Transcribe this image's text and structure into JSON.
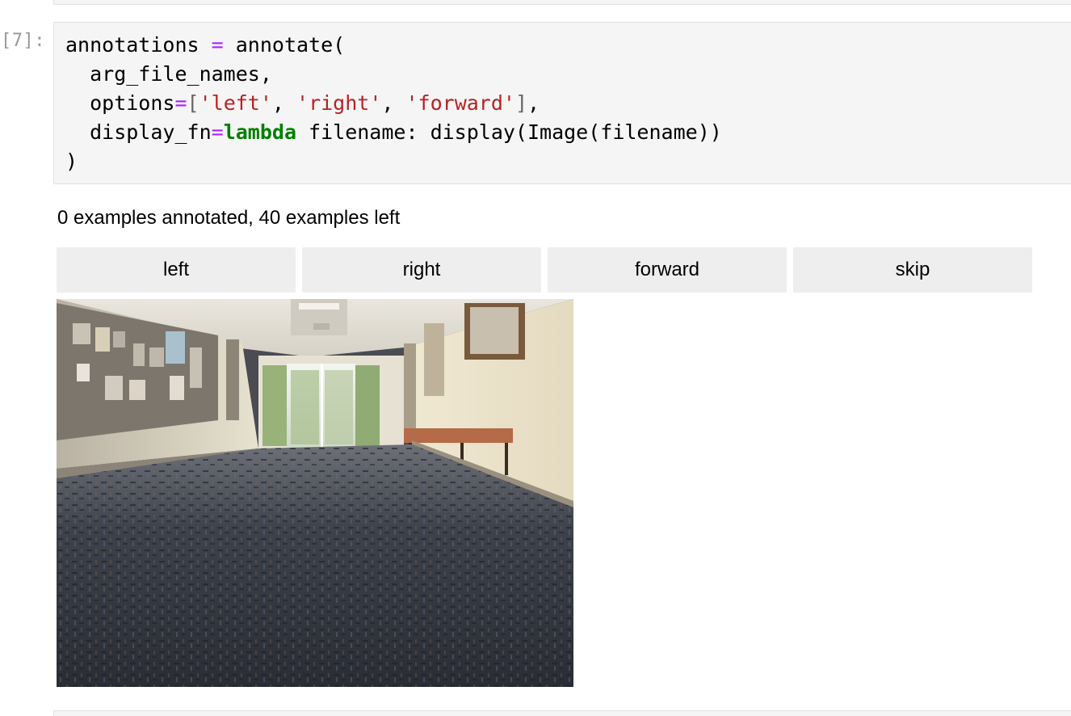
{
  "cell": {
    "prompt": "[7]:",
    "code_lines": [
      [
        {
          "t": "annotations ",
          "c": ""
        },
        {
          "t": "=",
          "c": "op"
        },
        {
          "t": " annotate(",
          "c": ""
        }
      ],
      [
        {
          "t": "  arg_file_names,",
          "c": ""
        }
      ],
      [
        {
          "t": "  options",
          "c": ""
        },
        {
          "t": "=",
          "c": "op"
        },
        {
          "t": "[",
          "c": "brk"
        },
        {
          "t": "'left'",
          "c": "str"
        },
        {
          "t": ", ",
          "c": ""
        },
        {
          "t": "'right'",
          "c": "str"
        },
        {
          "t": ", ",
          "c": ""
        },
        {
          "t": "'forward'",
          "c": "str"
        },
        {
          "t": "]",
          "c": "brk"
        },
        {
          "t": ",",
          "c": ""
        }
      ],
      [
        {
          "t": "  display_fn",
          "c": ""
        },
        {
          "t": "=",
          "c": "op"
        },
        {
          "t": "lambda",
          "c": "kw"
        },
        {
          "t": " filename: display(Image(filename))",
          "c": ""
        }
      ],
      [
        {
          "t": ")",
          "c": ""
        }
      ]
    ]
  },
  "output": {
    "status_text": "0 examples annotated, 40 examples left",
    "buttons": [
      {
        "label": "left"
      },
      {
        "label": "right"
      },
      {
        "label": "forward"
      },
      {
        "label": "skip"
      }
    ],
    "image": {
      "subject": "hallway-with-carpet-photo"
    }
  },
  "colors": {
    "cell_background": "#f5f5f5",
    "cell_border": "#e0e0e0",
    "button_background": "#eeeeee",
    "prompt": "#999999",
    "operator": "#aa22ff",
    "keyword": "#008000",
    "string": "#ba2121"
  }
}
